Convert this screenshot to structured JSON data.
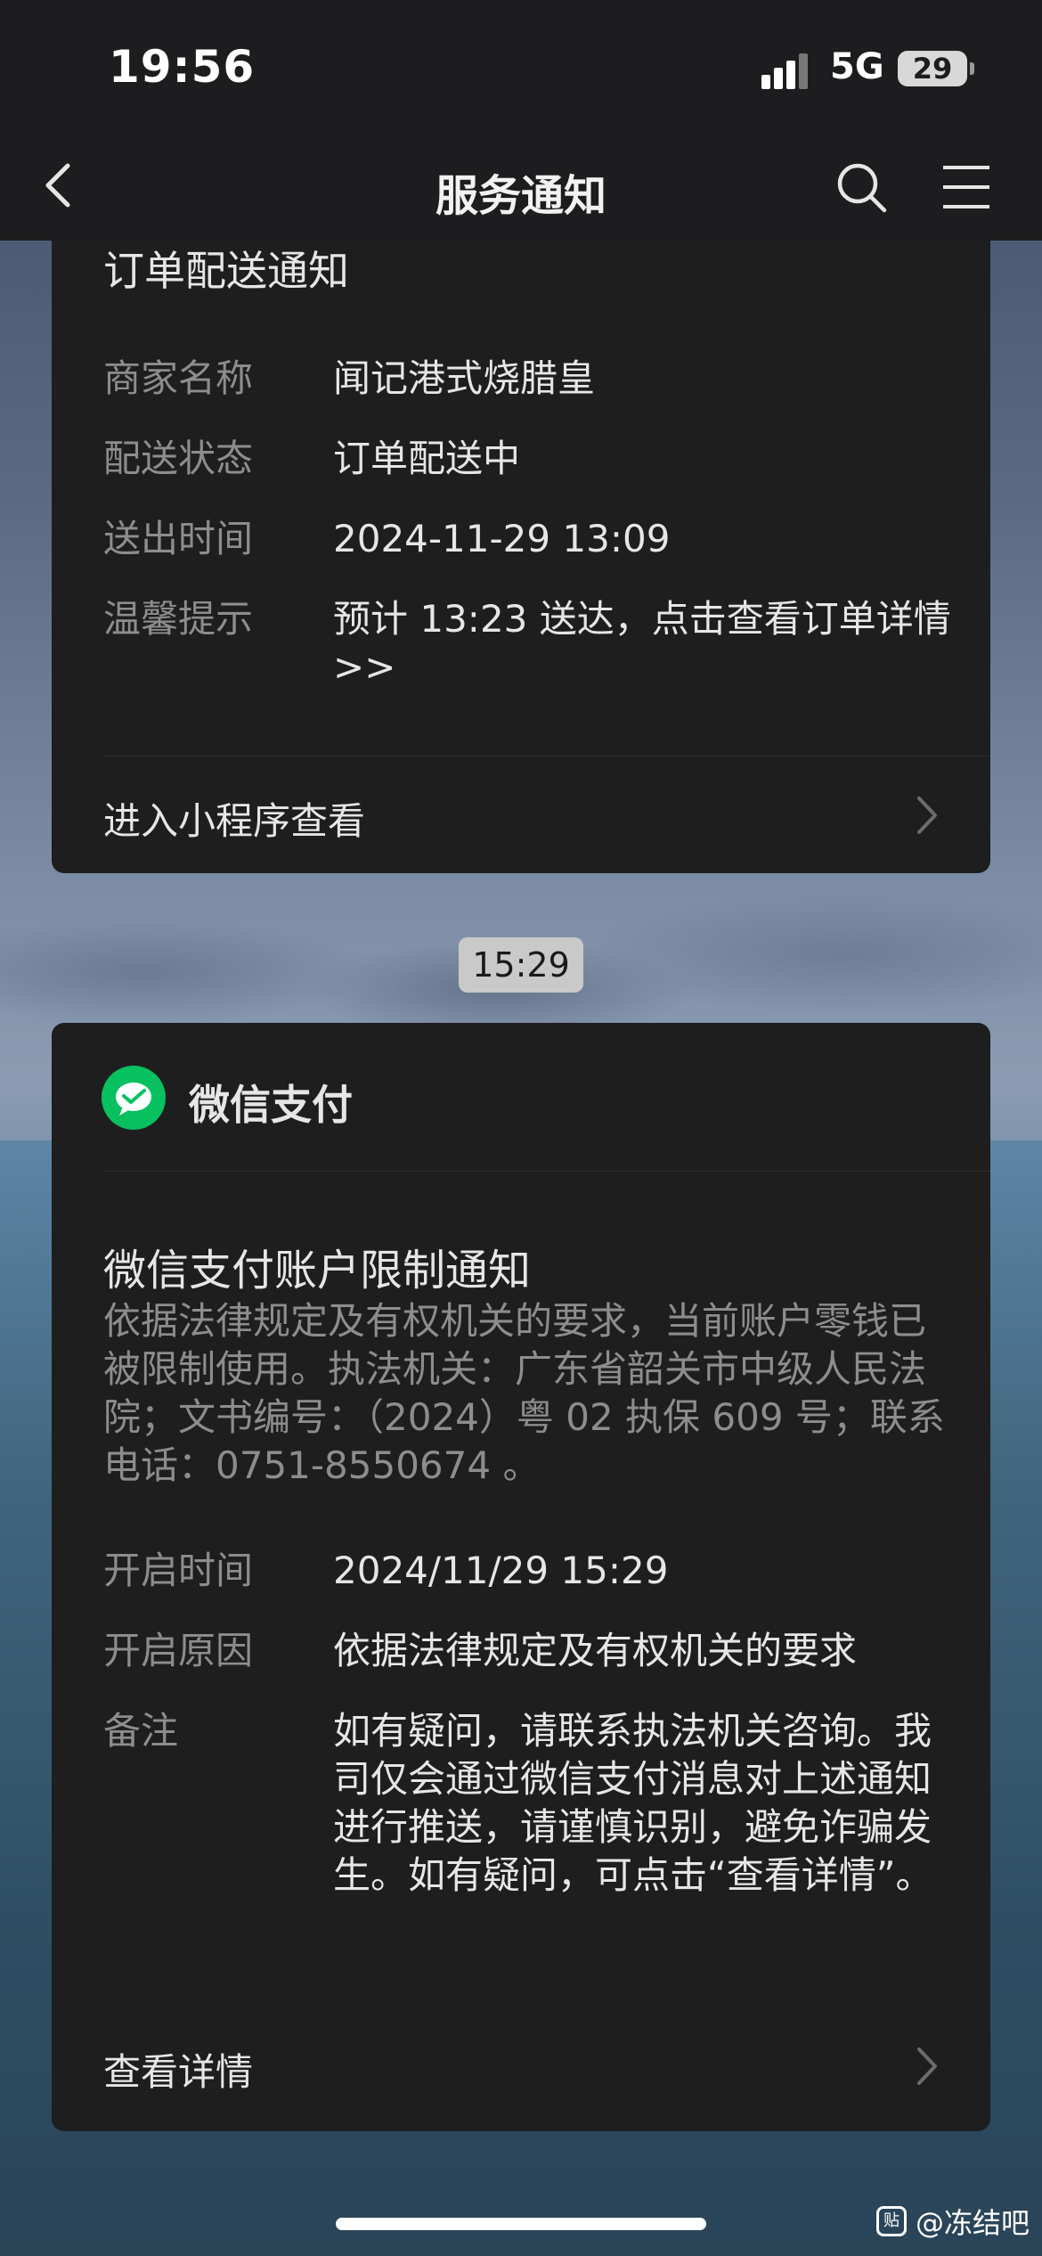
{
  "status_bar": {
    "time": "19:56",
    "network": "5G",
    "battery": "29"
  },
  "nav": {
    "title": "服务通知"
  },
  "order_card": {
    "title": "订单配送通知",
    "rows": [
      {
        "key": "商家名称",
        "value": "闻记港式烧腊皇"
      },
      {
        "key": "配送状态",
        "value": "订单配送中"
      },
      {
        "key": "送出时间",
        "value": "2024-11-29 13:09"
      },
      {
        "key": "温馨提示",
        "value": "预计 13:23 送达，点击查看订单详情>>"
      }
    ],
    "link": "进入小程序查看"
  },
  "timestamp": "15:29",
  "pay_card": {
    "sender": "微信支付",
    "title": "微信支付账户限制通知",
    "description": "依据法律规定及有权机关的要求，当前账户零钱已被限制使用。执法机关：广东省韶关市中级人民法院；文书编号：（2024）粤 02 执保 609 号；联系电话：0751-8550674 。",
    "rows": [
      {
        "key": "开启时间",
        "value": "2024/11/29 15:29"
      },
      {
        "key": "开启原因",
        "value": "依据法律规定及有权机关的要求"
      },
      {
        "key": "备注",
        "value": "如有疑问，请联系执法机关咨询。我司仅会通过微信支付消息对上述通知进行推送，请谨慎识别，避免诈骗发生。如有疑问，可点击“查看详情”。"
      }
    ],
    "link": "查看详情"
  },
  "watermark": {
    "icon": "贴",
    "text": "@冻结吧"
  },
  "icons": [
    "back-arrow-icon",
    "search-icon",
    "menu-icon",
    "chevron-right-icon",
    "wechat-pay-logo-icon"
  ]
}
